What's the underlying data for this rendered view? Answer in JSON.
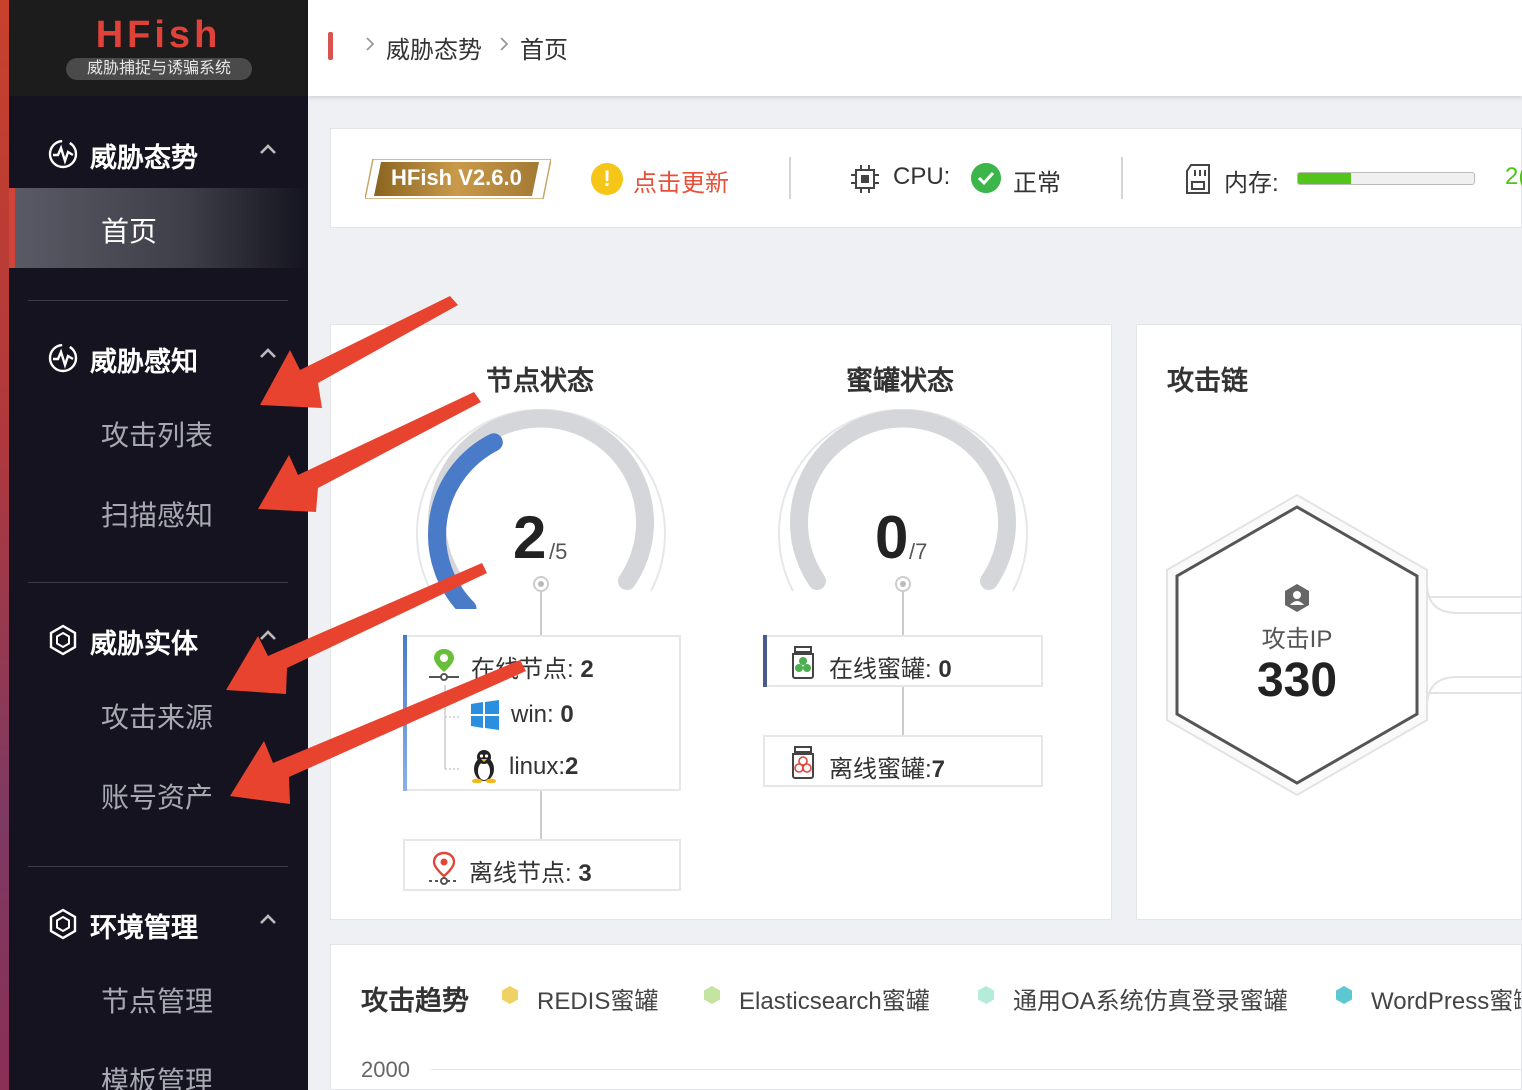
{
  "app": {
    "brand": "HFish",
    "slogan": "威胁捕捉与诱骗系统"
  },
  "breadcrumb": {
    "items": [
      "威胁态势",
      "首页"
    ]
  },
  "sidebar": {
    "groups": [
      {
        "label": "威胁态势",
        "items": [
          "首页"
        ]
      },
      {
        "label": "威胁感知",
        "items": [
          "攻击列表",
          "扫描感知"
        ]
      },
      {
        "label": "威胁实体",
        "items": [
          "攻击来源",
          "账号资产"
        ]
      },
      {
        "label": "环境管理",
        "items": [
          "节点管理",
          "模板管理"
        ]
      }
    ],
    "active_item": "首页"
  },
  "statusbar": {
    "version": "HFish V2.6.0",
    "update_label": "点击更新",
    "cpu_label": "CPU:",
    "cpu_status": "正常",
    "memory_label": "内存:",
    "memory_fill_fraction": 0.3,
    "memory_value_partial": "2("
  },
  "node_status": {
    "title": "节点状态",
    "online": 2,
    "total": 5,
    "online_num": "2",
    "total_label": "/5",
    "online_label": "在线节点: ",
    "online_value": "2",
    "win_label": "win: ",
    "win_value": "0",
    "linux_label": "linux:",
    "linux_value": "2",
    "offline_label": "离线节点: ",
    "offline_value": "3"
  },
  "honeypot_status": {
    "title": "蜜罐状态",
    "online": 0,
    "total": 7,
    "online_num": "0",
    "total_label": "/7",
    "online_label": "在线蜜罐: ",
    "online_value": "0",
    "offline_label": "离线蜜罐:",
    "offline_value": "7"
  },
  "attack_chain": {
    "title": "攻击链",
    "ip_label": "攻击IP",
    "ip_value": "330"
  },
  "attack_trend": {
    "title": "攻击趋势",
    "legend": [
      {
        "label": "REDIS蜜罐",
        "color": "#f0d264"
      },
      {
        "label": "Elasticsearch蜜罐",
        "color": "#c2e4a0"
      },
      {
        "label": "通用OA系统仿真登录蜜罐",
        "color": "#b5ecd9"
      },
      {
        "label": "WordPress蜜罐",
        "color": "#5ec8d0"
      }
    ],
    "y_tick": "2000"
  },
  "colors": {
    "accent_red": "#d0443a",
    "gauge_blue": "#4a7bc8",
    "gauge_grey": "#d4d6da",
    "ok_green": "#3cb64a",
    "warn_yellow": "#f5c518"
  }
}
